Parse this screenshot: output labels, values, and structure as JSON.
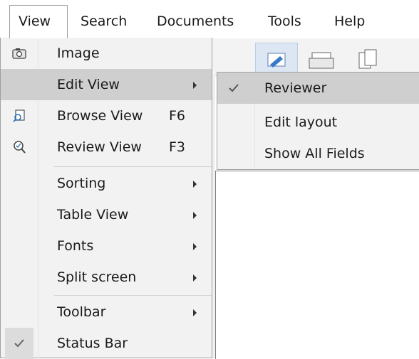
{
  "menubar": {
    "items": [
      {
        "label": "View"
      },
      {
        "label": "Search"
      },
      {
        "label": "Documents"
      },
      {
        "label": "Tools"
      },
      {
        "label": "Help"
      }
    ]
  },
  "view_menu": {
    "items": [
      {
        "label": "Image",
        "icon": "camera-icon"
      },
      {
        "label": "Edit View",
        "has_submenu": true
      },
      {
        "label": "Browse View",
        "shortcut": "F6",
        "icon": "browse-icon"
      },
      {
        "label": "Review View",
        "shortcut": "F3",
        "icon": "review-icon"
      },
      {
        "label": "Sorting",
        "has_submenu": true
      },
      {
        "label": "Table View",
        "has_submenu": true
      },
      {
        "label": "Fonts",
        "has_submenu": true
      },
      {
        "label": "Split screen",
        "has_submenu": true
      },
      {
        "label": "Toolbar",
        "has_submenu": true
      },
      {
        "label": "Status Bar",
        "checked": true
      }
    ]
  },
  "edit_view_submenu": {
    "items": [
      {
        "label": "Reviewer",
        "checked": true
      },
      {
        "label": "Edit layout"
      },
      {
        "label": "Show All Fields"
      }
    ]
  },
  "colors": {
    "highlight": "#cfcfcf",
    "menu_bg": "#f2f2f2",
    "border": "#a0a0a0",
    "toolbar_active": "#dce7f3"
  }
}
